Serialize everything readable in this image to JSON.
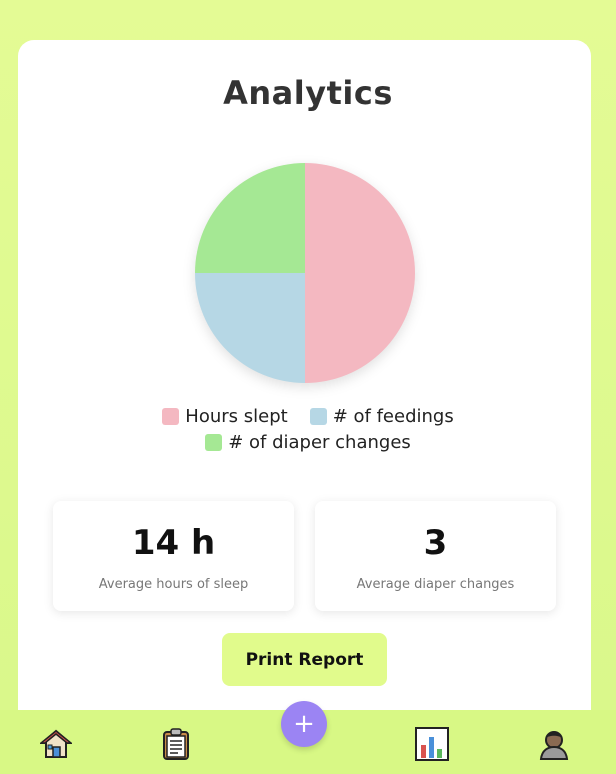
{
  "page": {
    "title": "Analytics"
  },
  "chart_data": {
    "type": "pie",
    "categories": [
      "Hours slept",
      "# of feedings",
      "# of diaper changes"
    ],
    "values": [
      50,
      25,
      25
    ],
    "colors": [
      "#f4b8c1",
      "#b6d7e5",
      "#a5e894"
    ],
    "legend_placement": "bottom"
  },
  "stats": [
    {
      "value": "14 h",
      "label": "Average hours of sleep"
    },
    {
      "value": "3",
      "label": "Average diaper changes"
    }
  ],
  "actions": {
    "print_label": "Print Report",
    "add_label": "+"
  },
  "nav": {
    "items": [
      {
        "name": "home",
        "icon": "house-icon"
      },
      {
        "name": "log",
        "icon": "clipboard-icon"
      },
      {
        "name": "analytics",
        "icon": "bar-chart-icon"
      },
      {
        "name": "profile",
        "icon": "user-icon"
      }
    ]
  }
}
